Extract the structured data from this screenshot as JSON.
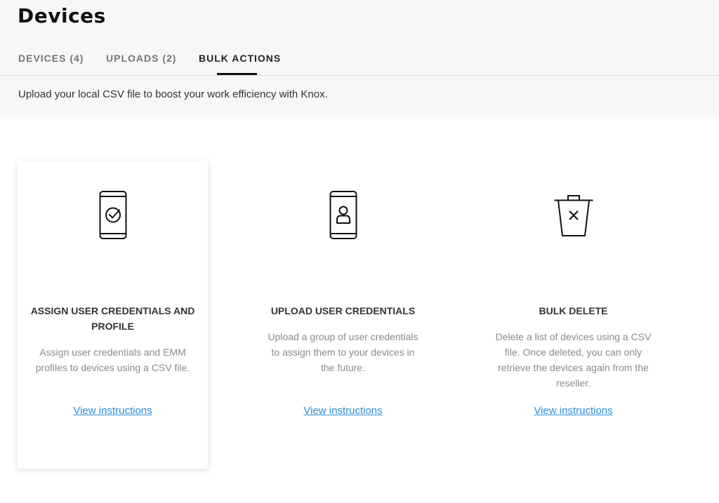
{
  "page": {
    "title": "Devices",
    "intro": "Upload your local CSV file to boost your work efficiency with Knox."
  },
  "tabs": [
    {
      "label": "DEVICES (4)",
      "active": false
    },
    {
      "label": "UPLOADS (2)",
      "active": false
    },
    {
      "label": "BULK ACTIONS",
      "active": true
    }
  ],
  "cards": [
    {
      "icon": "phone-check-icon",
      "title": "ASSIGN USER CREDENTIALS AND PROFILE",
      "description": "Assign user credentials and EMM profiles to devices using a CSV file.",
      "link": "View instructions"
    },
    {
      "icon": "phone-user-icon",
      "title": "UPLOAD USER CREDENTIALS",
      "description": "Upload a group of user credentials to assign them to your devices in the future.",
      "link": "View instructions"
    },
    {
      "icon": "trash-delete-icon",
      "title": "BULK DELETE",
      "description": "Delete a list of devices using a CSV file. Once deleted, you can only retrieve the devices again from the reseller.",
      "link": "View instructions"
    }
  ],
  "colors": {
    "link": "#2f8fd6",
    "header_bg": "#f7f7f7",
    "active_tab": "#111111"
  }
}
